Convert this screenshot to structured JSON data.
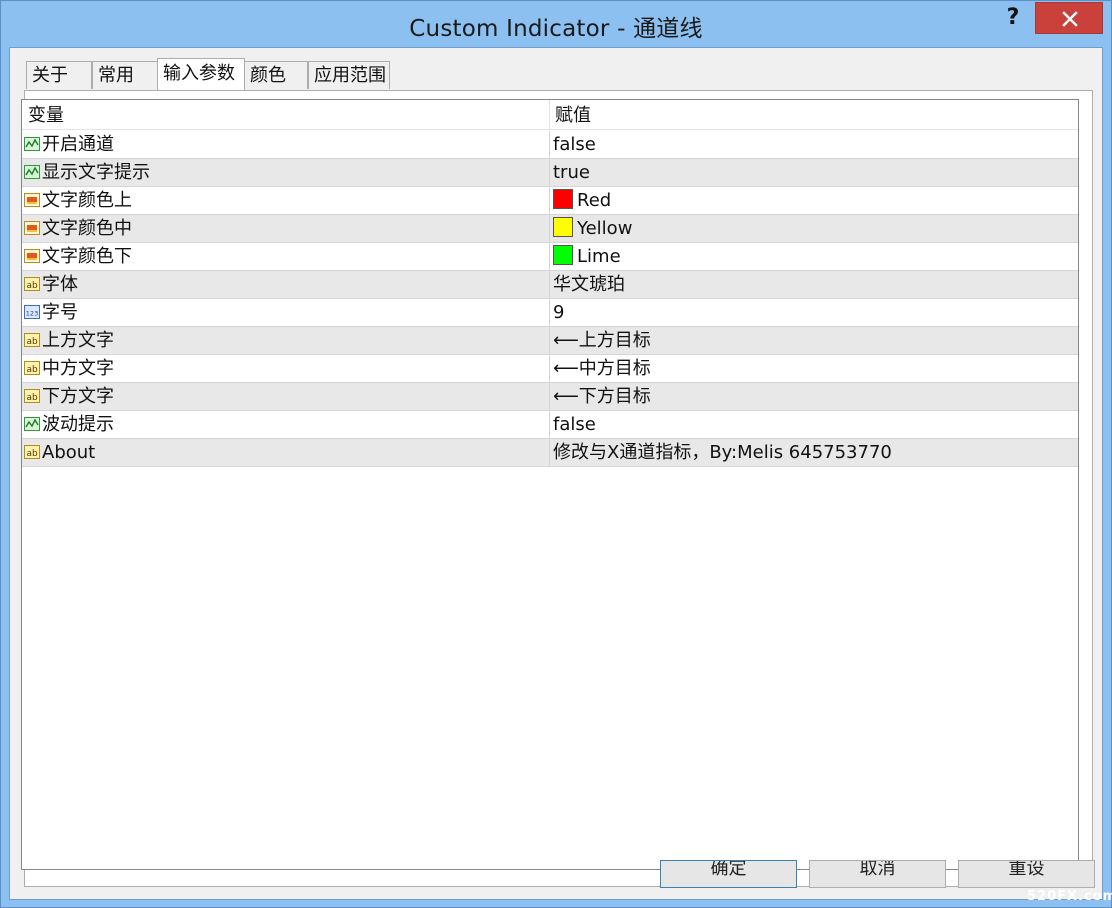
{
  "window": {
    "title": "Custom Indicator - 通道线",
    "help_label": "?"
  },
  "tabs": [
    {
      "label": "关于",
      "active": false
    },
    {
      "label": "常用",
      "active": false
    },
    {
      "label": "输入参数",
      "active": true
    },
    {
      "label": "颜色",
      "active": false
    },
    {
      "label": "应用范围",
      "active": false
    }
  ],
  "grid": {
    "columns": [
      "变量",
      "赋值"
    ],
    "rows": [
      {
        "icon": "bool-icon",
        "name": "开启通道",
        "value": "false"
      },
      {
        "icon": "bool-icon",
        "name": "显示文字提示",
        "value": "true"
      },
      {
        "icon": "color-icon",
        "name": "文字颜色上",
        "value": "Red",
        "swatch": "#ff0000"
      },
      {
        "icon": "color-icon",
        "name": "文字颜色中",
        "value": "Yellow",
        "swatch": "#ffff00"
      },
      {
        "icon": "color-icon",
        "name": "文字颜色下",
        "value": "Lime",
        "swatch": "#00ff00"
      },
      {
        "icon": "string-icon",
        "name": "字体",
        "value": "华文琥珀"
      },
      {
        "icon": "integer-icon",
        "name": "字号",
        "value": "9"
      },
      {
        "icon": "string-icon",
        "name": "上方文字",
        "value": "⟵上方目标"
      },
      {
        "icon": "string-icon",
        "name": "中方文字",
        "value": "⟵中方目标"
      },
      {
        "icon": "string-icon",
        "name": "下方文字",
        "value": "⟵下方目标"
      },
      {
        "icon": "bool-icon",
        "name": "波动提示",
        "value": "false"
      },
      {
        "icon": "string-icon",
        "name": "About",
        "value": "修改与X通道指标，By:Melis 645753770"
      }
    ]
  },
  "buttons": {
    "ok": "确定",
    "cancel": "取消",
    "reset": "重设"
  },
  "watermark": "520FX.com",
  "colors": {
    "titlebar": "#8cc0f0",
    "close": "#c9413a",
    "alt_row": "#e8e8e8"
  }
}
